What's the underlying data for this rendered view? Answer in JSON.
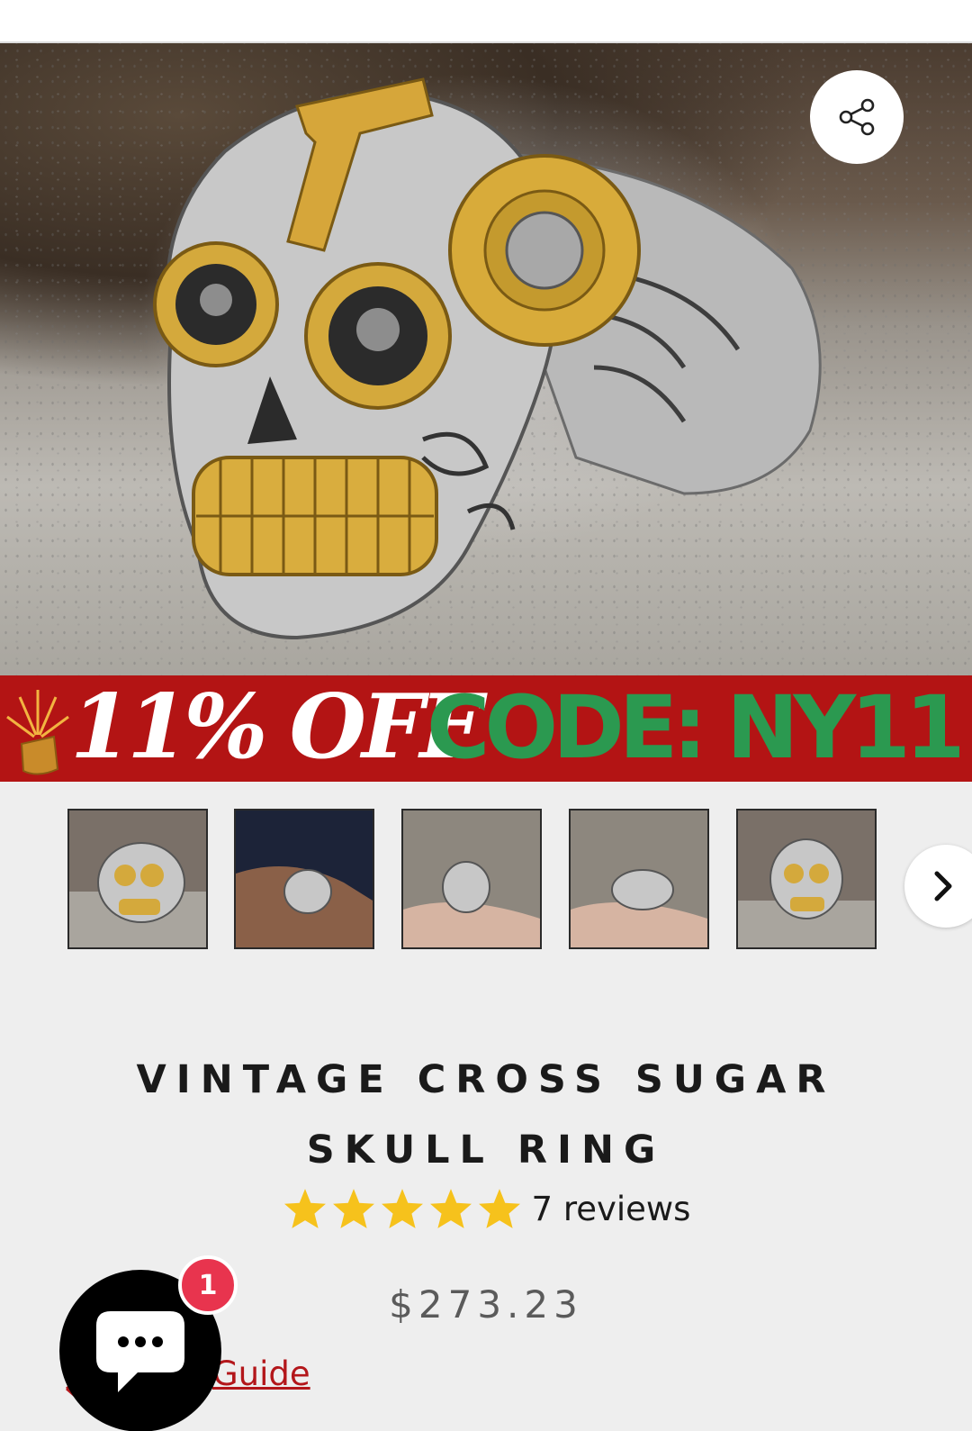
{
  "promo": {
    "discount_text": "11% OFF",
    "code_text": "CODE: NY11"
  },
  "product": {
    "title": "VINTAGE CROSS SUGAR SKULL RING",
    "rating": 5,
    "rating_max": 5,
    "reviews_text": "7 reviews",
    "price": "$273.23"
  },
  "size_guide": {
    "label": "Guide"
  },
  "chat": {
    "badge_count": "1"
  },
  "icons": {
    "share": "share-icon",
    "next": "chevron-right-icon",
    "star": "star-icon",
    "chat": "chat-bubble-icon"
  },
  "colors": {
    "promo_bg": "#b31414",
    "promo_code": "#2b9950",
    "star": "#f6c21c",
    "guide_link": "#b3161a",
    "badge": "#e8344e"
  },
  "gallery": {
    "thumbnail_count": 5
  }
}
